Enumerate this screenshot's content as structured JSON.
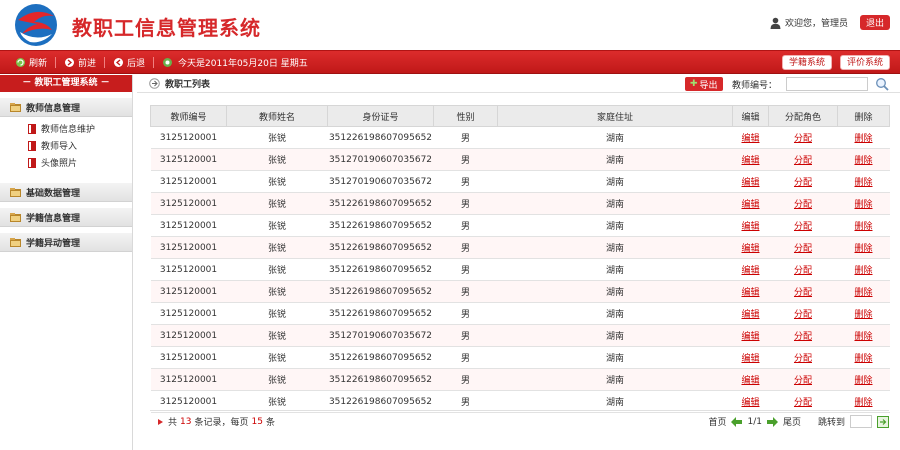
{
  "header": {
    "title": "教职工信息管理系统",
    "welcome": "欢迎您，管理员",
    "logout": "退出"
  },
  "nav": {
    "refresh": "刷新",
    "back": "前进",
    "forward": "后退",
    "date": "今天是2011年05月20日 星期五",
    "btn_grade": "学籍系统",
    "btn_eval": "评价系统"
  },
  "sidebar": {
    "title": "教职工管理系统",
    "groups": [
      {
        "label": "教师信息管理",
        "items": [
          "教师信息维护",
          "教师导入",
          "头像照片"
        ]
      },
      {
        "label": "基础数据管理",
        "items": []
      },
      {
        "label": "学籍信息管理",
        "items": []
      },
      {
        "label": "学籍异动管理",
        "items": []
      }
    ]
  },
  "content": {
    "title": "教职工列表",
    "export": "导出",
    "search_label": "教师编号：",
    "search_value": ""
  },
  "table": {
    "headers": [
      "教师编号",
      "教师姓名",
      "身份证号",
      "性别",
      "家庭住址",
      "编辑",
      "分配角色",
      "删除"
    ],
    "rows": [
      [
        "3125120001",
        "张锐",
        "351226198607095652",
        "男",
        "湖南",
        "编辑",
        "分配",
        "删除"
      ],
      [
        "3125120001",
        "张锐",
        "351270190607035672",
        "男",
        "湖南",
        "编辑",
        "分配",
        "删除"
      ],
      [
        "3125120001",
        "张锐",
        "351270190607035672",
        "男",
        "湖南",
        "编辑",
        "分配",
        "删除"
      ],
      [
        "3125120001",
        "张锐",
        "351226198607095652",
        "男",
        "湖南",
        "编辑",
        "分配",
        "删除"
      ],
      [
        "3125120001",
        "张锐",
        "351226198607095652",
        "男",
        "湖南",
        "编辑",
        "分配",
        "删除"
      ],
      [
        "3125120001",
        "张锐",
        "351226198607095652",
        "男",
        "湖南",
        "编辑",
        "分配",
        "删除"
      ],
      [
        "3125120001",
        "张锐",
        "351226198607095652",
        "男",
        "湖南",
        "编辑",
        "分配",
        "删除"
      ],
      [
        "3125120001",
        "张锐",
        "351226198607095652",
        "男",
        "湖南",
        "编辑",
        "分配",
        "删除"
      ],
      [
        "3125120001",
        "张锐",
        "351226198607095652",
        "男",
        "湖南",
        "编辑",
        "分配",
        "删除"
      ],
      [
        "3125120001",
        "张锐",
        "351270190607035672",
        "男",
        "湖南",
        "编辑",
        "分配",
        "删除"
      ],
      [
        "3125120001",
        "张锐",
        "351226198607095652",
        "男",
        "湖南",
        "编辑",
        "分配",
        "删除"
      ],
      [
        "3125120001",
        "张锐",
        "351226198607095652",
        "男",
        "湖南",
        "编辑",
        "分配",
        "删除"
      ],
      [
        "3125120001",
        "张锐",
        "351226198607095652",
        "男",
        "湖南",
        "编辑",
        "分配",
        "删除"
      ]
    ]
  },
  "footer": {
    "prefix": "共",
    "total": "13",
    "mid": "条记录，每页",
    "per_page": "15",
    "suffix": "条",
    "first": "首页",
    "page_info": "1/1",
    "last": "尾页",
    "jump_label": "跳转到"
  },
  "colors": {
    "brand_red": "#d6282a",
    "nav_red": "#c01818"
  }
}
